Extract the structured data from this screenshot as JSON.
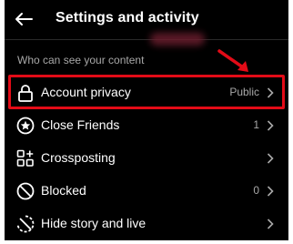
{
  "header": {
    "title": "Settings and activity",
    "back_icon": "arrow-left-icon"
  },
  "section": {
    "title": "Who can see your content"
  },
  "items": [
    {
      "label": "Account privacy",
      "value": "Public",
      "icon": "lock-icon"
    },
    {
      "label": "Close Friends",
      "value": "1",
      "icon": "star-circle-icon"
    },
    {
      "label": "Crossposting",
      "value": "",
      "icon": "grid-plus-icon"
    },
    {
      "label": "Blocked",
      "value": "0",
      "icon": "blocked-icon"
    },
    {
      "label": "Hide story and live",
      "value": "",
      "icon": "hide-story-icon"
    }
  ],
  "annotation": {
    "highlight_color": "#e30b17",
    "highlighted_item": "Account privacy"
  }
}
